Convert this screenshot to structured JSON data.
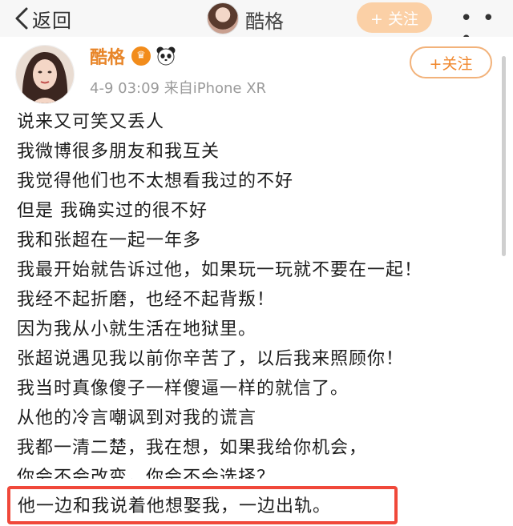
{
  "nav": {
    "back_label": "返回",
    "title_name": "酷格",
    "follow_label": "+ 关注",
    "more_glyph": "• • •"
  },
  "post": {
    "author": "酷格",
    "meta": "4-9 03:09  来自iPhone XR",
    "follow_label": "+关注",
    "lines": [
      "说来又可笑又丢人",
      "我微博很多朋友和我互关",
      "我觉得他们也不太想看我过的不好",
      "但是 我确实过的很不好",
      "我和张超在一起一年多",
      "我最开始就告诉过他，如果玩一玩就不要在一起！",
      "我经不起折磨，也经不起背叛！",
      "因为我从小就生活在地狱里。",
      "张超说遇见我以前你辛苦了，以后我来照顾你！",
      "我当时真像傻子一样傻逼一样的就信了。",
      "从他的冷言嘲讽到对我的谎言",
      "我都一清二楚，我在想，如果我给你机会，"
    ],
    "partial_line": "你会不会改变，你会不会选择？",
    "highlighted_line": "他一边和我说着他想娶我，一边出轨。"
  },
  "colors": {
    "accent": "#f0872c",
    "highlight_box": "#f0483a",
    "meta": "#9a9a9a"
  }
}
